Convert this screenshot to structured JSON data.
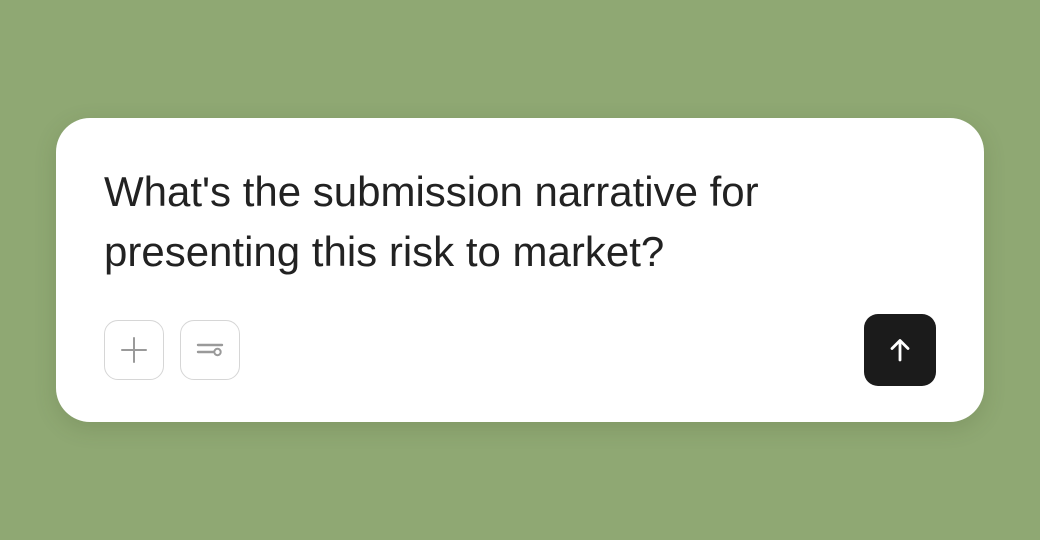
{
  "composer": {
    "prompt_text": "What's the submission narrative for presenting this risk to market?",
    "add_icon": "plus-icon",
    "settings_icon": "sliders-icon",
    "send_icon": "arrow-up-icon"
  },
  "colors": {
    "background": "#8fa873",
    "card": "#ffffff",
    "text": "#222222",
    "send_button": "#1b1b1b",
    "tool_border": "#d6d6d6",
    "tool_icon": "#9a9a9a"
  }
}
